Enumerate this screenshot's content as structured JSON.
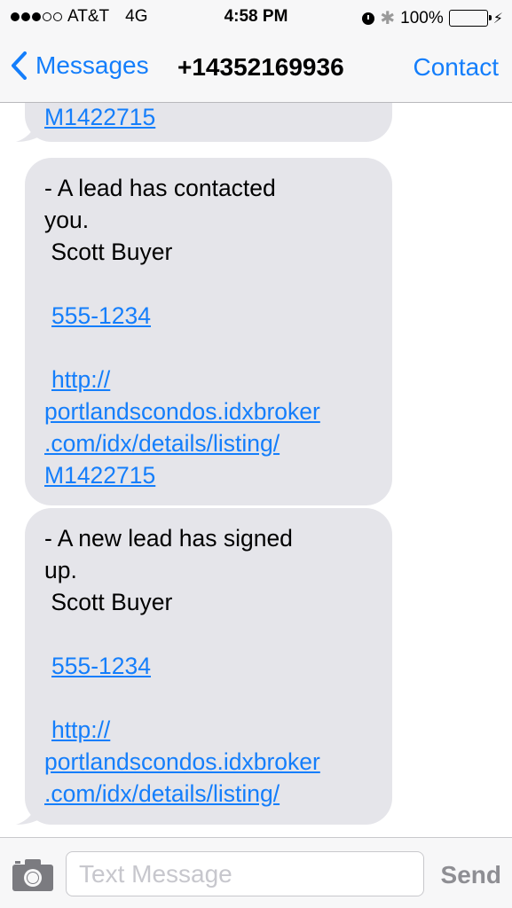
{
  "status_bar": {
    "signal_dots_filled": 3,
    "signal_dots_total": 5,
    "carrier": "AT&T",
    "network": "4G",
    "time": "4:58 PM",
    "battery_percent": "100%",
    "icons": [
      "alarm-icon",
      "bluetooth-icon",
      "battery-icon",
      "charging-bolt-icon"
    ]
  },
  "nav": {
    "back_label": "Messages",
    "title": "+14352169936",
    "contact_label": "Contact"
  },
  "messages": [
    {
      "partial": true,
      "lines": [
        {
          "text": "M1422715",
          "link": true
        }
      ]
    },
    {
      "lines": [
        {
          "text": "- A lead has contacted",
          "link": false
        },
        {
          "text": "you.",
          "link": false
        },
        {
          "text": " Scott Buyer",
          "link": false
        },
        {
          "text": "",
          "link": false
        },
        {
          "text": "555-1234",
          "link": true,
          "indent": true
        },
        {
          "text": "",
          "link": false
        },
        {
          "text": "http://",
          "link": true,
          "indent": true
        },
        {
          "text": "portlandscondos.idxbroker",
          "link": true
        },
        {
          "text": ".com/idx/details/listing/",
          "link": true
        },
        {
          "text": "M1422715",
          "link": true
        }
      ]
    },
    {
      "lines": [
        {
          "text": "- A new lead has signed",
          "link": false
        },
        {
          "text": "up.",
          "link": false
        },
        {
          "text": " Scott Buyer",
          "link": false
        },
        {
          "text": "",
          "link": false
        },
        {
          "text": "555-1234",
          "link": true,
          "indent": true
        },
        {
          "text": "",
          "link": false
        },
        {
          "text": "http://",
          "link": true,
          "indent": true
        },
        {
          "text": "portlandscondos.idxbroker",
          "link": true
        },
        {
          "text": ".com/idx/details/listing/",
          "link": true
        }
      ]
    }
  ],
  "composer": {
    "placeholder": "Text Message",
    "value": "",
    "send_label": "Send"
  },
  "colors": {
    "accent": "#147efb",
    "bubble": "#e5e5ea",
    "battery": "#4cd964",
    "send_disabled": "#8e8e93"
  }
}
